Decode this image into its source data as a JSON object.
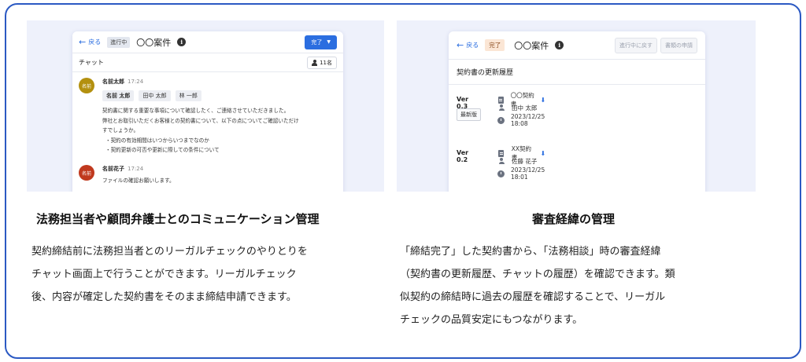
{
  "left": {
    "chat": {
      "back_label": "戻る",
      "status_tag": "進行中",
      "title": "〇〇案件",
      "complete_button": "完了",
      "section_label": "チャット",
      "member_count": "11名",
      "messages": [
        {
          "avatar": "名前",
          "avatar_color": "#b3900f",
          "name": "名前太郎",
          "time": "17:24",
          "mentions": [
            "名前 太郎",
            "田中 太郎",
            "林 一郎"
          ],
          "lines": [
            "契約書に関する重要な事項について確認したく、ご連絡させていただきました。",
            "弊社とお取引いただくお客様との契約書について、以下の点についてご確認いただけ",
            "すでしょうか。",
            "・契約の有効期間はいつからいつまでなのか",
            "・契約更新の可否や更新に際しての条件について"
          ]
        },
        {
          "avatar": "名前",
          "avatar_color": "#c0391e",
          "name": "名前花子",
          "time": "17:24",
          "lines": [
            "ファイルの確認お願いします。"
          ]
        }
      ]
    },
    "caption_title": "法務担当者や顧問弁護士とのコミュニケーション管理",
    "caption_lines": [
      "契約締結前に法務担当者とのリーガルチェックのやりとりを",
      "チャット画面上で行うことができます。リーガルチェック",
      "後、内容が確定した契約書をそのまま締結申請できます。"
    ]
  },
  "right": {
    "history": {
      "back_label": "戻る",
      "status_tag": "完了",
      "title": "〇〇案件",
      "revert_button": "進行中に戻す",
      "apply_button": "書類の申請",
      "section_label": "契約書の更新履歴",
      "versions": [
        {
          "label": "Ver 0.3",
          "badge": "最新版",
          "file": "〇〇契約書",
          "user": "田中 太郎",
          "datetime": "2023/12/25 18:08"
        },
        {
          "label": "Ver 0.2",
          "file": "XX契約書",
          "user": "佐藤 花子",
          "datetime": "2023/12/25 18:01"
        }
      ]
    },
    "caption_title": "審査経緯の管理",
    "caption_lines": [
      "「締結完了」した契約書から、「法務相談」時の審査経緯",
      "（契約書の更新履歴、チャットの履歴）を確認できます。類",
      "似契約の締結時に過去の履歴を確認することで、リーガル",
      "チェックの品質安定にもつながります。"
    ]
  }
}
